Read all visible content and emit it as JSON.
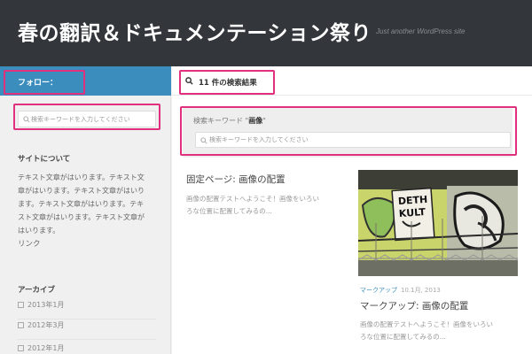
{
  "header": {
    "title": "春の翻訳＆ドキュメンテーション祭り",
    "tagline": "Just another WordPress site"
  },
  "sidebar": {
    "follow_label": "フォロー：",
    "search": {
      "placeholder": "検索キーワードを入力してください"
    },
    "about": {
      "title": "サイトについて",
      "lines": [
        "テキスト文章がはいります。テキスト文",
        "章がはいります。テキスト文章がはいり",
        "ます。テキスト文章がはいります。テキ",
        "スト文章がはいります。テキスト文章が",
        "はいります。"
      ]
    },
    "link_label": "リンク",
    "archive": {
      "title": "アーカイブ",
      "items": [
        "2013年1月",
        "2012年3月",
        "2012年1月"
      ]
    }
  },
  "main": {
    "results_label": "11 件の検索結果",
    "search_box": {
      "label_prefix": "検索キーワード \"",
      "keyword": "画像",
      "label_suffix": "\"",
      "placeholder": "検索キーワードを入力してください"
    },
    "posts": [
      {
        "title": "固定ページ: 画像の配置",
        "excerpt_lines": [
          "画像の配置テストへようこそ！画像をいろい",
          "ろな位置に配置してみるの..."
        ]
      },
      {
        "category": "マークアップ",
        "date": "10.1月, 2013",
        "title": "マークアップ: 画像の配置",
        "excerpt_lines": [
          "画像の配置テストへようこそ！画像をいろい",
          "ろな位置に配置してみるの..."
        ]
      }
    ]
  },
  "colors": {
    "header_bg": "#33363b",
    "accent_blue": "#3b8dbd",
    "highlight_pink": "#e0307e"
  }
}
